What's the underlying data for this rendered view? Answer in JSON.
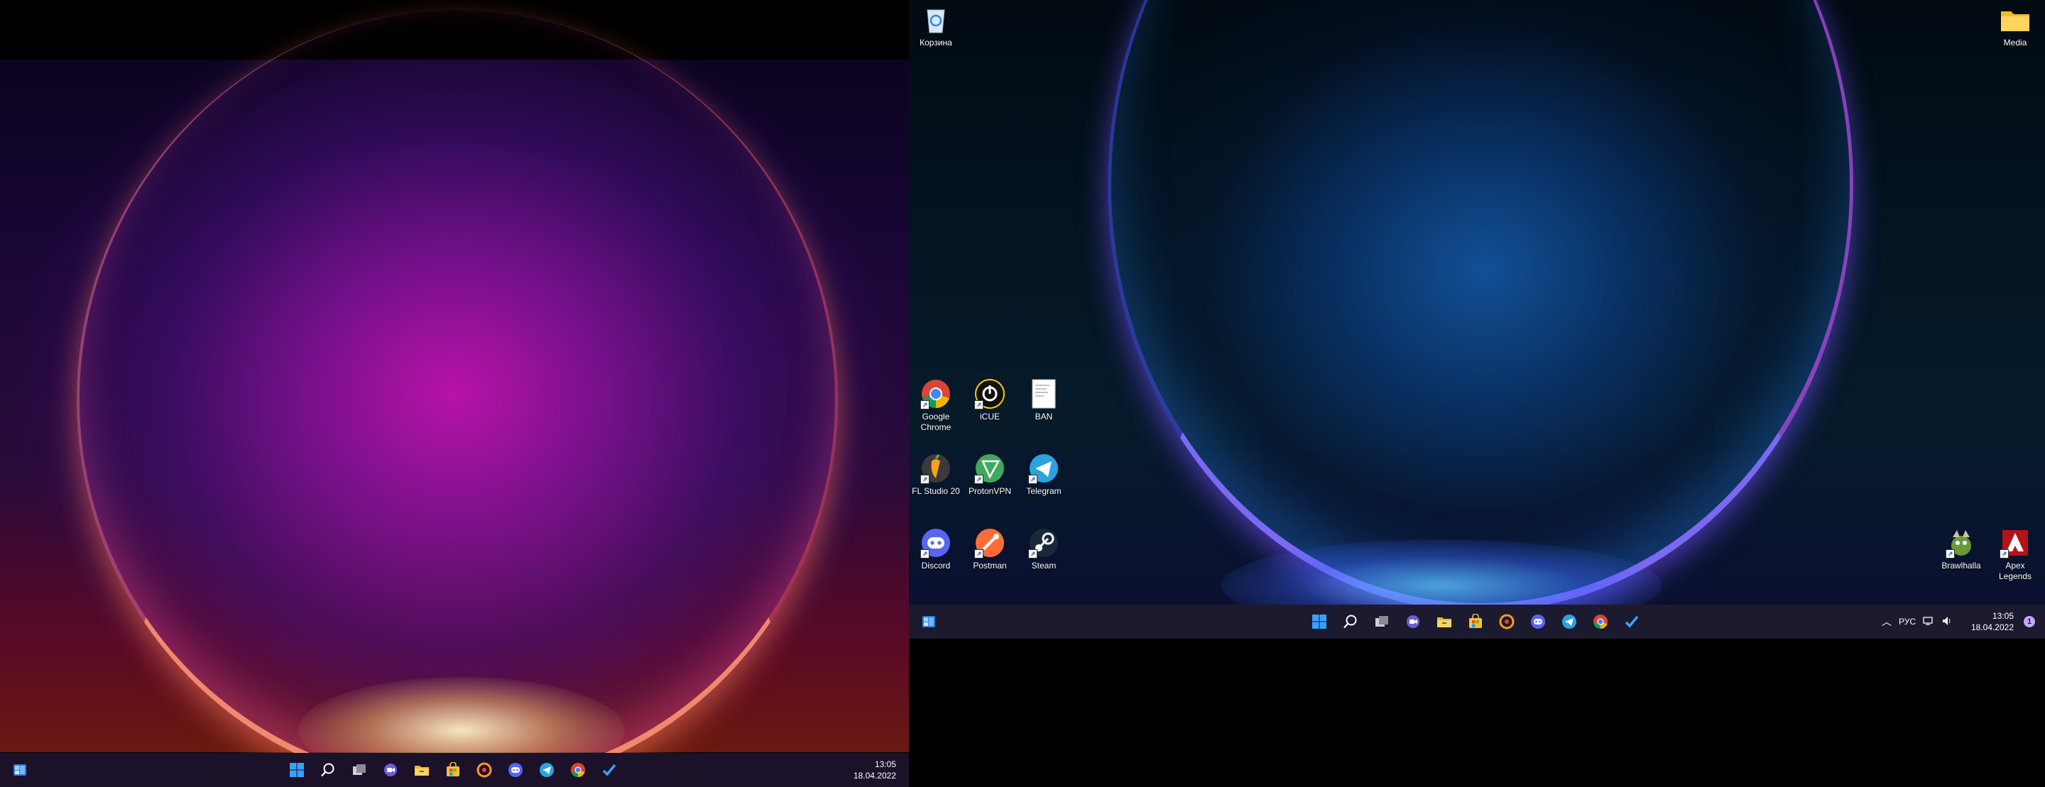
{
  "left_monitor": {
    "clock": {
      "time": "13:05",
      "date": "18.04.2022"
    }
  },
  "right_monitor": {
    "desktop_icons": {
      "recycle_bin": "Корзина",
      "media": "Media",
      "google_chrome": "Google Chrome",
      "icue": "iCUE",
      "ban": "BAN",
      "fl_studio": "FL Studio 20",
      "protonvpn": "ProtonVPN",
      "telegram": "Telegram",
      "discord": "Discord",
      "postman": "Postman",
      "steam": "Steam",
      "brawlhalla": "Brawlhalla",
      "apex": "Apex Legends"
    },
    "tray": {
      "language": "РУС",
      "time": "13:05",
      "date": "18.04.2022",
      "notification_count": "1"
    }
  },
  "taskbar_apps": [
    "start-icon",
    "search-icon",
    "task-view-icon",
    "chat-icon",
    "file-explorer-icon",
    "store-icon",
    "yandex-music-icon",
    "discord-icon",
    "telegram-icon",
    "chrome-icon",
    "todo-icon"
  ],
  "colors": {
    "taskbar_left": "#1b1128",
    "taskbar_right": "#1c1a2e",
    "windows_blue": "#3aa0ff"
  }
}
